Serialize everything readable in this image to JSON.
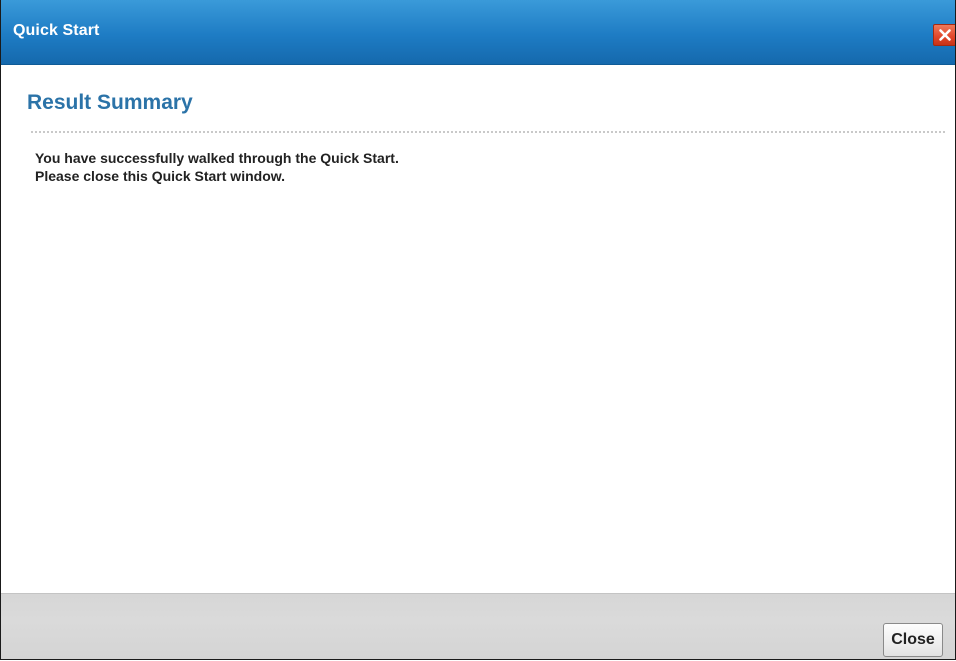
{
  "window": {
    "title": "Quick Start"
  },
  "content": {
    "heading": "Result Summary",
    "messages": [
      "You have successfully walked through the Quick Start.",
      "Please close this Quick Start window."
    ]
  },
  "footer": {
    "close_label": "Close"
  },
  "icons": {
    "title_close": "close-icon"
  },
  "colors": {
    "titlebar": "#1e7cc4",
    "heading": "#2b73a8",
    "close_icon_bg": "#e0462a",
    "footer_bg": "#d6d6d6"
  }
}
